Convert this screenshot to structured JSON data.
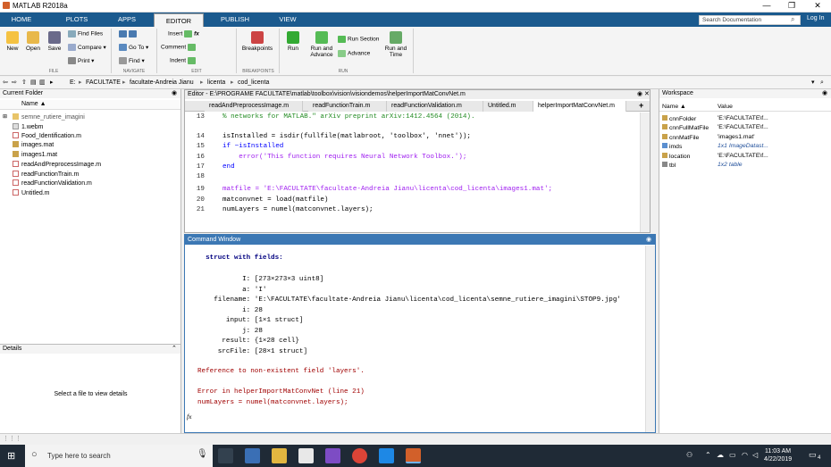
{
  "title": "MATLAB R2018a",
  "tabs": [
    "HOME",
    "PLOTS",
    "APPS",
    "EDITOR",
    "PUBLISH",
    "VIEW"
  ],
  "search_placeholder": "Search Documentation",
  "login": "Log In",
  "toolstrip": {
    "new": "New",
    "open": "Open",
    "save": "Save",
    "find_files": "Find Files",
    "compare": "Compare ▾",
    "print": "Print ▾",
    "goto": "Go To ▾",
    "find": "Find ▾",
    "insert": "Insert",
    "comment": "Comment",
    "indent": "Indent",
    "breakpoints": "Breakpoints",
    "run": "Run",
    "run_advance": "Run and Advance",
    "run_section": "Run Section",
    "advance": "Advance",
    "run_time": "Run and Time",
    "sections": [
      "FILE",
      "NAVIGATE",
      "EDIT",
      "BREAKPOINTS",
      "RUN"
    ]
  },
  "address": [
    "E:",
    "FACULTATE",
    "facultate-Andreia Jianu",
    "licenta",
    "cod_licenta"
  ],
  "current_folder": {
    "title": "Current Folder",
    "name_col": "Name ▲",
    "items": [
      "semne_rutiere_imagini",
      "1.webm",
      "Food_Identification.m",
      "images.mat",
      "images1.mat",
      "readAndPreprocessImage.m",
      "readFunctionTrain.m",
      "readFunctionValidation.m",
      "Untitled.m"
    ]
  },
  "details": {
    "title": "Details",
    "empty": "Select a file to view details"
  },
  "editor": {
    "title": "Editor - E:\\PROGRAME FACULTATE\\matlab\\toolbox\\vision\\visiondemos\\helperImportMatConvNet.m",
    "tabs": [
      "readAndPreprocessImage.m",
      "readFunctionTrain.m",
      "readFunctionValidation.m",
      "Untitled.m",
      "helperImportMatConvNet.m"
    ],
    "lines": [
      {
        "n": "13",
        "t": "% networks for MATLAB.\" arXiv preprint arXiv:1412.4564 (2014)."
      },
      {
        "n": "14",
        "t": "isInstalled = isdir(fullfile(matlabroot, 'toolbox', 'nnet'));"
      },
      {
        "n": "15",
        "t": "if ~isInstalled"
      },
      {
        "n": "16",
        "t": "    error('This function requires Neural Network Toolbox.');"
      },
      {
        "n": "17",
        "t": "end"
      },
      {
        "n": "18",
        "t": ""
      },
      {
        "n": "19",
        "t": "matfile = 'E:\\FACULTATE\\facultate-Andreia Jianu\\licenta\\cod_licenta\\images1.mat';"
      },
      {
        "n": "20",
        "t": "matconvnet = load(matfile)"
      },
      {
        "n": "21",
        "t": "numLayers = numel(matconvnet.layers);"
      }
    ]
  },
  "command_window": {
    "title": "Command Window",
    "lines": [
      "  struct with fields:",
      "",
      "           I: [273×273×3 uint8]",
      "           a: 'I'",
      "    filename: 'E:\\FACULTATE\\facultate-Andreia Jianu\\licenta\\cod_licenta\\semne_rutiere_imagini\\STOP9.jpg'",
      "           i: 28",
      "       input: [1×1 struct]",
      "           j: 28",
      "      result: {1×28 cell}",
      "     srcFile: [28×1 struct]",
      "",
      "Reference to non-existent field 'layers'.",
      "",
      "Error in helperImportMatConvNet (line 21)",
      "numLayers = numel(matconvnet.layers);"
    ],
    "prompt": "fx"
  },
  "workspace": {
    "title": "Workspace",
    "cols": [
      "Name ▲",
      "Value"
    ],
    "rows": [
      {
        "name": "cnnFolder",
        "value": "'E:\\FACULTATE\\f..."
      },
      {
        "name": "cnnFullMatFile",
        "value": "'E:\\FACULTATE\\f..."
      },
      {
        "name": "cnnMatFile",
        "value": "'images1.mat'"
      },
      {
        "name": "imds",
        "value": "1x1 ImageDatast..."
      },
      {
        "name": "location",
        "value": "'E:\\FACULTATE\\f..."
      },
      {
        "name": "tbl",
        "value": "1x2 table"
      }
    ]
  },
  "taskbar": {
    "search": "Type here to search",
    "time": "11:03 AM",
    "date": "4/22/2019",
    "notif": "4"
  },
  "colors": {
    "titlebar": "#1b5a8e",
    "cmd_header": "#3c78b4",
    "error": "#a00000",
    "keyword": "#0000ff",
    "string": "#a020f0",
    "comment": "#228b22"
  }
}
